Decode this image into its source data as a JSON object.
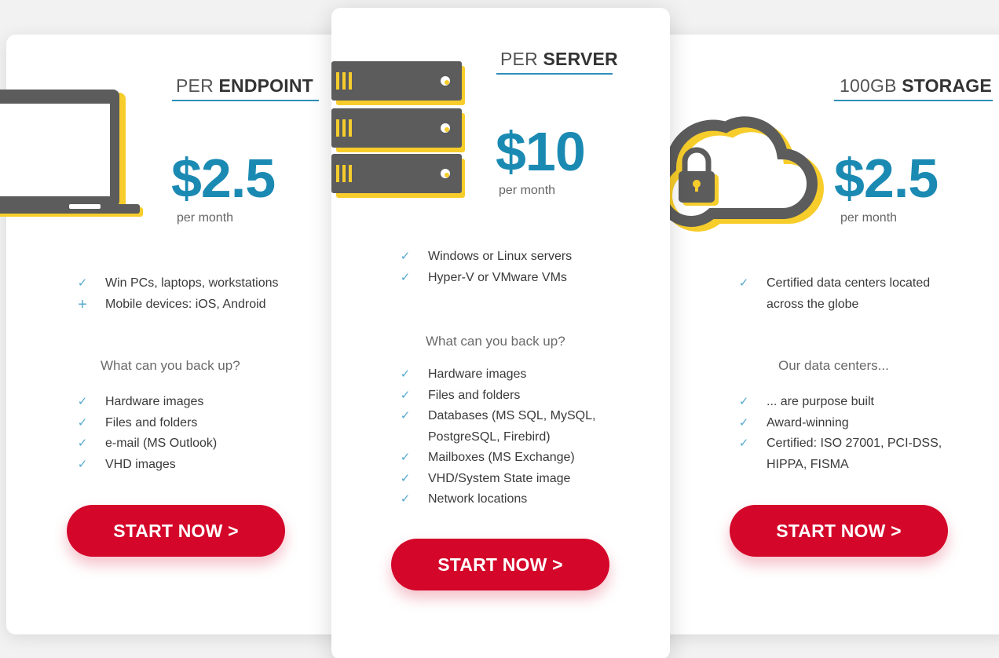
{
  "colors": {
    "accent_blue": "#1b8ab3",
    "cta_red": "#d4062a",
    "icon_gray": "#5c5c5c",
    "icon_yellow": "#f7cd2b"
  },
  "plans": [
    {
      "title_light": "PER ",
      "title_bold": "ENDPOINT",
      "icon": "laptop-icon",
      "price": "$2.5",
      "period": "per month",
      "features": [
        {
          "mark": "check",
          "text": "Win PCs, laptops, workstations"
        },
        {
          "mark": "plus",
          "text": "Mobile devices: iOS, Android"
        }
      ],
      "section_heading": "What can you back up?",
      "items": [
        "Hardware images",
        "Files and folders",
        "e-mail (MS Outlook)",
        "VHD images"
      ],
      "cta": "START NOW >"
    },
    {
      "title_light": "PER ",
      "title_bold": "SERVER",
      "icon": "server-rack-icon",
      "price": "$10",
      "period": "per month",
      "features": [
        {
          "mark": "check",
          "text": "Windows or Linux servers"
        },
        {
          "mark": "check",
          "text": "Hyper-V or VMware VMs"
        }
      ],
      "section_heading": "What can you back up?",
      "items": [
        "Hardware images",
        "Files and folders",
        "Databases (MS SQL, MySQL,",
        "PostgreSQL, Firebird)",
        "Mailboxes (MS Exchange)",
        "VHD/System State image",
        "Network locations"
      ],
      "cta": "START NOW >"
    },
    {
      "title_light": "100GB ",
      "title_bold": "STORAGE",
      "icon": "cloud-lock-icon",
      "price": "$2.5",
      "period": "per month",
      "features": [
        {
          "mark": "check",
          "text": "Certified data centers located"
        },
        {
          "mark": "none",
          "text": "across the globe"
        }
      ],
      "section_heading": "Our data centers...",
      "items": [
        "... are purpose built",
        "Award-winning",
        "Certified: ISO 27001, PCI-DSS,",
        "HIPPA, FISMA"
      ],
      "cta": "START NOW >"
    }
  ]
}
